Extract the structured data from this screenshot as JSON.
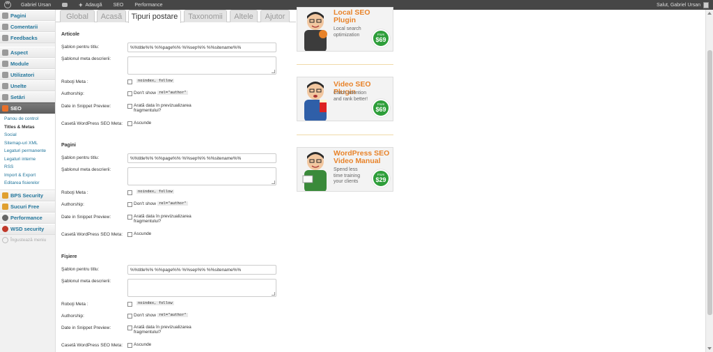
{
  "adminbar": {
    "user": "Gabriel Ursan",
    "add_new": "Adaugă",
    "seo": "SEO",
    "performance": "Performance",
    "greeting": "Salut, Gabriel Ursan"
  },
  "sidebar": {
    "items": [
      {
        "label": "Pagini",
        "icon": "pages-icon"
      },
      {
        "label": "Comentarii",
        "icon": "comments-icon"
      },
      {
        "label": "Feedbacks",
        "icon": "feedback-icon"
      },
      {
        "label": "Aspect",
        "icon": "appearance-icon"
      },
      {
        "label": "Module",
        "icon": "plugins-icon"
      },
      {
        "label": "Utilizatori",
        "icon": "users-icon"
      },
      {
        "label": "Unelte",
        "icon": "tools-icon"
      },
      {
        "label": "Setări",
        "icon": "settings-icon"
      },
      {
        "label": "SEO",
        "icon": "seo-icon"
      }
    ],
    "seo_submenu": [
      "Panou de control",
      "Titles & Metas",
      "Social",
      "Sitemap-uri XML",
      "Legaturi permanente",
      "Legaturi interne",
      "RSS",
      "Import & Export",
      "Editarea fisierelor"
    ],
    "extra_items": [
      {
        "label": "BPS Security",
        "icon": "bps-security-icon"
      },
      {
        "label": "Sucuri Free",
        "icon": "sucuri-icon"
      },
      {
        "label": "Performance",
        "icon": "performance-icon"
      },
      {
        "label": "WSD security",
        "icon": "wsd-security-icon"
      }
    ],
    "collapse": "Îngustează meniu"
  },
  "tabs": [
    "Global",
    "Acasă",
    "Tipuri postare",
    "Taxonomii",
    "Altele",
    "Ajutor"
  ],
  "form": {
    "title_template_label": "Şablon pentru titlu:",
    "meta_template_label": "Şablonul meta descrierii:",
    "robots_label": "Roboţi Meta :",
    "robots_code": "noindex, follow",
    "authorship_label": "Authorship:",
    "authorship_text": "Don't show",
    "authorship_code": "rel=\"author\"",
    "date_label": "Date in Snippet Preview:",
    "date_text_line1": "Arată data în previzualizarea",
    "date_text_line2": "fragmentului?",
    "metabox_label": "Casetă WordPress SEO Meta:",
    "metabox_text": "Ascunde",
    "title_value": "%%title%% %%page%% %%sep%% %%sitename%%",
    "sections": [
      "Articole",
      "Pagini",
      "Fişiere"
    ]
  },
  "ads": [
    {
      "title_line1": "Local SEO",
      "title_line2": "Plugin",
      "sub_line1": "Local search",
      "sub_line2": "optimization",
      "sub_line3": "",
      "from": "From",
      "price": "$69"
    },
    {
      "title_line1": "Video SEO Plugin",
      "title_line2": "",
      "sub_line1": "Catch attention",
      "sub_line2": "and rank better!",
      "sub_line3": "",
      "from": "From",
      "price": "$69"
    },
    {
      "title_line1": "WordPress SEO",
      "title_line2": "Video Manual",
      "sub_line1": "Spend less",
      "sub_line2": "time training",
      "sub_line3": "your clients",
      "from": "From",
      "price": "$29"
    }
  ]
}
